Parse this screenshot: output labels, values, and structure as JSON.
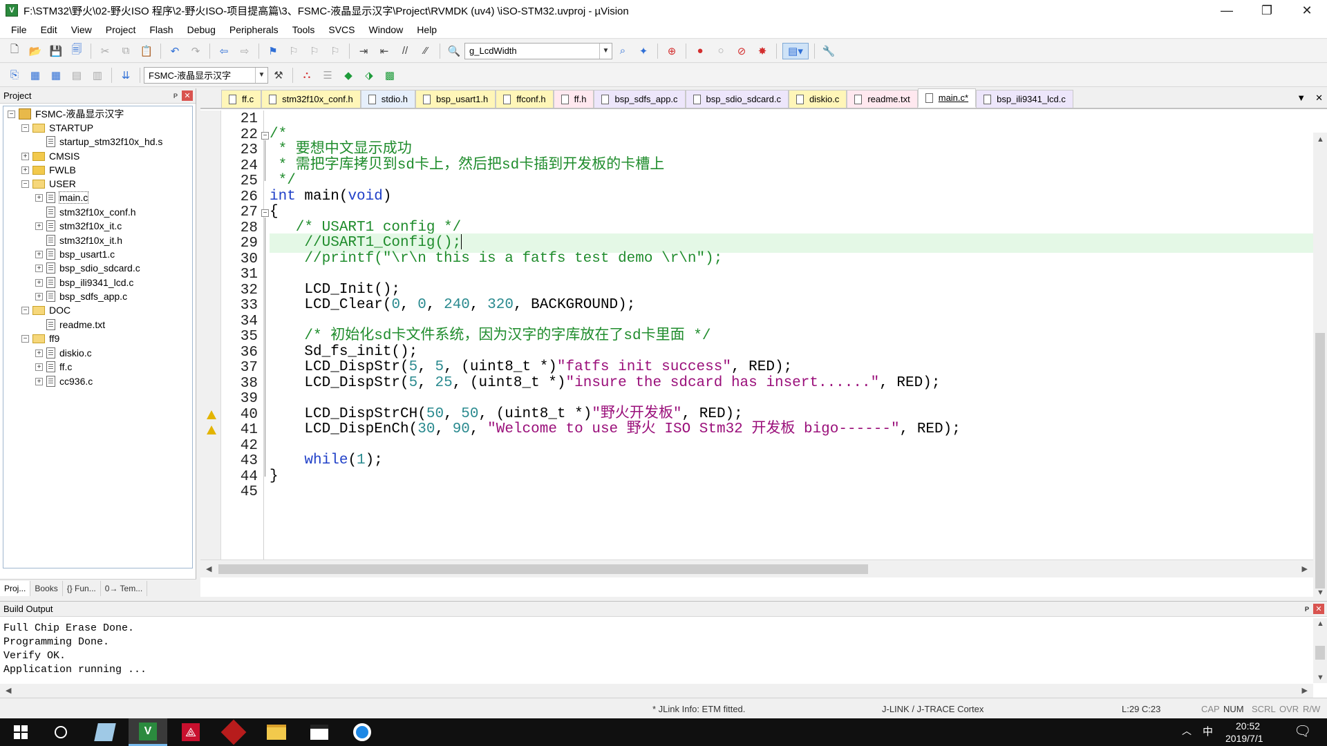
{
  "window": {
    "title": "F:\\STM32\\野火\\02-野火ISO 程序\\2-野火ISO-项目提高篇\\3、FSMC-液晶显示汉字\\Project\\RVMDK  (uv4)  \\iSO-STM32.uvproj - µVision",
    "minimize": "—",
    "maximize": "❐",
    "close": "✕"
  },
  "menu": [
    "File",
    "Edit",
    "View",
    "Project",
    "Flash",
    "Debug",
    "Peripherals",
    "Tools",
    "SVCS",
    "Window",
    "Help"
  ],
  "toolbar1": {
    "find_combo_value": "g_LcdWidth"
  },
  "toolbar2": {
    "target_combo_value": "FSMC-液晶显示汉字"
  },
  "project_panel": {
    "title": "Project",
    "pin": "ᴘ",
    "close": "✕",
    "root": "FSMC-液晶显示汉字",
    "groups": [
      {
        "name": "STARTUP",
        "files": [
          "startup_stm32f10x_hd.s"
        ]
      },
      {
        "name": "CMSIS",
        "files": []
      },
      {
        "name": "FWLB",
        "files": []
      },
      {
        "name": "USER",
        "files": [
          "main.c",
          "stm32f10x_conf.h",
          "stm32f10x_it.c",
          "stm32f10x_it.h",
          "bsp_usart1.c",
          "bsp_sdio_sdcard.c",
          "bsp_ili9341_lcd.c",
          "bsp_sdfs_app.c"
        ]
      },
      {
        "name": "DOC",
        "files": [
          "readme.txt"
        ]
      },
      {
        "name": "ff9",
        "files": [
          "diskio.c",
          "ff.c",
          "cc936.c"
        ]
      }
    ],
    "tabs": [
      "Proj...",
      "Books",
      "{} Fun...",
      "0→ Tem..."
    ]
  },
  "editor": {
    "tabs": [
      {
        "label": "ff.c",
        "color": "yellow"
      },
      {
        "label": "stm32f10x_conf.h",
        "color": "yellow"
      },
      {
        "label": "stdio.h",
        "color": "blue"
      },
      {
        "label": "bsp_usart1.h",
        "color": "yellow"
      },
      {
        "label": "ffconf.h",
        "color": "yellow"
      },
      {
        "label": "ff.h",
        "color": "pink"
      },
      {
        "label": "bsp_sdfs_app.c",
        "color": "purple"
      },
      {
        "label": "bsp_sdio_sdcard.c",
        "color": "purple"
      },
      {
        "label": "diskio.c",
        "color": "yellow"
      },
      {
        "label": "readme.txt",
        "color": "pink"
      },
      {
        "label": "main.c*",
        "color": "active"
      },
      {
        "label": "bsp_ili9341_lcd.c",
        "color": "purple"
      }
    ],
    "tab_menu": "▼",
    "tab_close": "✕",
    "line_numbers": [
      21,
      22,
      23,
      24,
      25,
      26,
      27,
      28,
      29,
      30,
      31,
      32,
      33,
      34,
      35,
      36,
      37,
      38,
      39,
      40,
      41,
      42,
      43,
      44,
      45
    ],
    "current_line": 29,
    "warning_lines": [
      40,
      41
    ],
    "code_lines": [
      "",
      "/*",
      " * 要想中文显示成功",
      " * 需把字库拷贝到sd卡上，然后把sd卡插到开发板的卡槽上",
      " */",
      "int main(void)",
      "{",
      "   /* USART1 config */",
      "    //USART1_Config();",
      "    //printf(\"\\r\\n this is a fatfs test demo \\r\\n\");",
      "",
      "    LCD_Init();",
      "    LCD_Clear(0, 0, 240, 320, BACKGROUND);",
      "",
      "    /* 初始化sd卡文件系统，因为汉字的字库放在了sd卡里面 */",
      "    Sd_fs_init();",
      "    LCD_DispStr(5, 5, (uint8_t *)\"fatfs init success\", RED);",
      "    LCD_DispStr(5, 25, (uint8_t *)\"insure the sdcard has insert......\", RED);",
      "",
      "    LCD_DispStrCH(50, 50, (uint8_t *)\"野火开发板\", RED);",
      "    LCD_DispEnCh(30, 90, \"Welcome to use 野火 ISO Stm32 开发板 bigo------\", RED);",
      "",
      "    while(1);",
      "}",
      ""
    ]
  },
  "build_output": {
    "title": "Build Output",
    "pin": "ᴘ",
    "close": "✕",
    "lines": [
      "Full Chip Erase Done.",
      "Programming Done.",
      "Verify OK.",
      "Application running ..."
    ]
  },
  "status_bar": {
    "jlink_info": "* JLink Info: ETM fitted.",
    "debugger": "J-LINK / J-TRACE Cortex",
    "position": "L:29 C:23",
    "cap": "CAP",
    "num": "NUM",
    "scrl": "SCRL",
    "ovr": "OVR",
    "rw": "R/W"
  },
  "taskbar": {
    "ime": "中",
    "time": "20:52",
    "date": "2019/7/1"
  },
  "colors": {
    "comment": "#1f8c2c",
    "keyword": "#2040c8",
    "number": "#2a8a8f",
    "string": "#9a0f7a",
    "current_line": "#e4f8e6"
  }
}
